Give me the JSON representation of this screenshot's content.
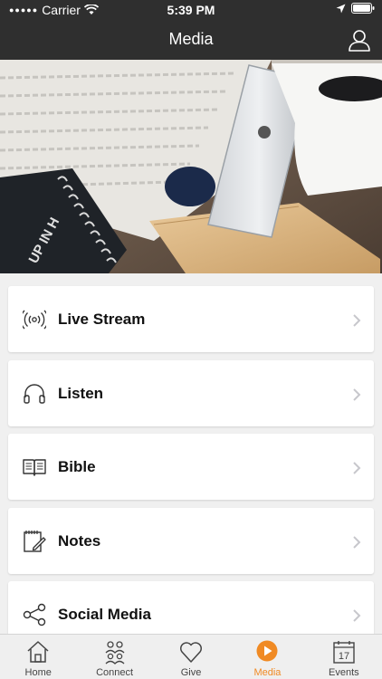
{
  "status_bar": {
    "carrier": "Carrier",
    "time": "5:39 PM"
  },
  "nav": {
    "title": "Media"
  },
  "menu": {
    "items": [
      {
        "label": "Live Stream",
        "icon": "broadcast-icon"
      },
      {
        "label": "Listen",
        "icon": "headphones-icon"
      },
      {
        "label": "Bible",
        "icon": "open-book-icon"
      },
      {
        "label": "Notes",
        "icon": "notepad-pencil-icon"
      },
      {
        "label": "Social Media",
        "icon": "share-icon"
      }
    ]
  },
  "hero": {
    "notebook_text": "UP IN H"
  },
  "tabs": [
    {
      "label": "Home",
      "icon": "home-icon"
    },
    {
      "label": "Connect",
      "icon": "people-icon"
    },
    {
      "label": "Give",
      "icon": "heart-icon"
    },
    {
      "label": "Media",
      "icon": "play-icon",
      "active": true
    },
    {
      "label": "Events",
      "icon": "calendar-icon",
      "calendar_day": "17"
    }
  ],
  "colors": {
    "bar": "#2f2f2f",
    "accent": "#f08a24",
    "background": "#f0f0f0"
  }
}
